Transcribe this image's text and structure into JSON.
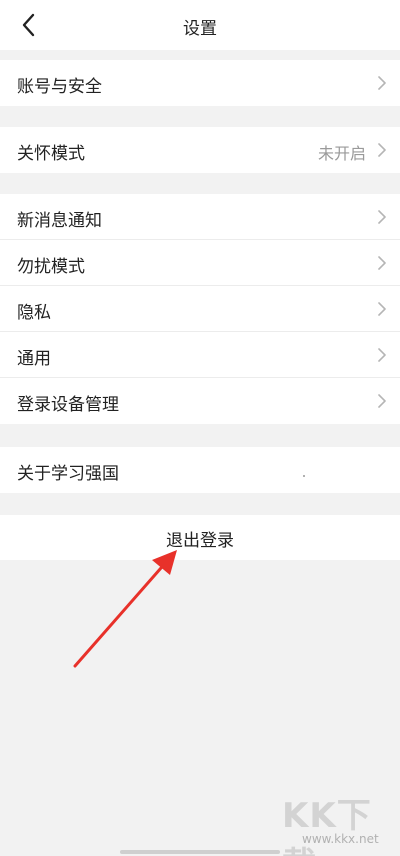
{
  "header": {
    "title": "设置",
    "back_icon": "chevron-left-icon"
  },
  "groups": {
    "account": {
      "items": [
        {
          "label": "账号与安全"
        }
      ]
    },
    "care": {
      "items": [
        {
          "label": "关怀模式",
          "value": "未开启"
        }
      ]
    },
    "general": {
      "items": [
        {
          "label": "新消息通知"
        },
        {
          "label": "勿扰模式"
        },
        {
          "label": "隐私"
        },
        {
          "label": "通用"
        },
        {
          "label": "登录设备管理"
        }
      ]
    },
    "about": {
      "items": [
        {
          "label": "关于学习强国"
        }
      ]
    }
  },
  "logout": {
    "label": "退出登录"
  },
  "annotation": {
    "color": "#e8312a"
  },
  "watermark": {
    "logo": "KK下载",
    "url": "www.kkx.net"
  }
}
